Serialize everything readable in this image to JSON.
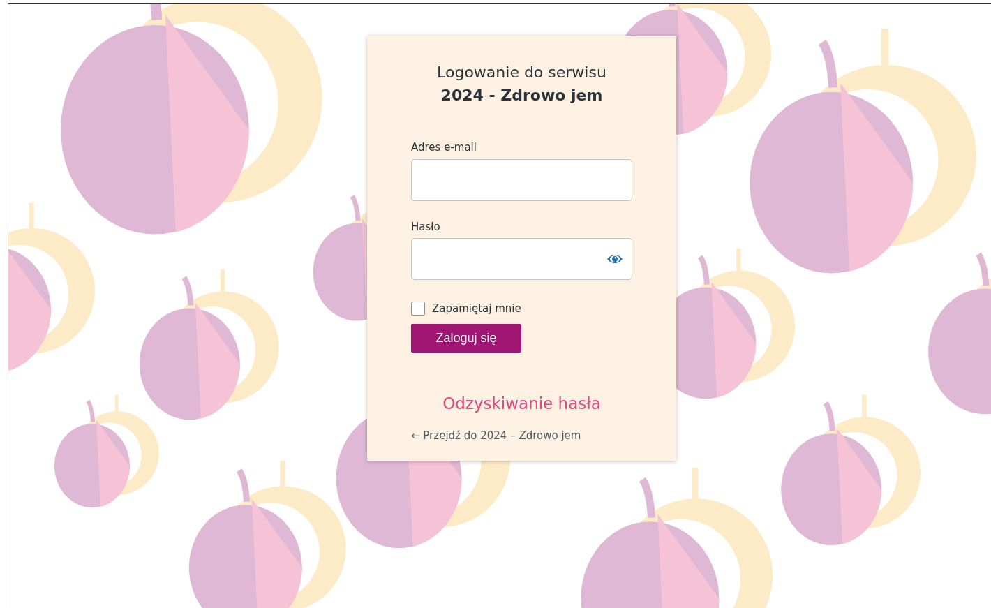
{
  "title": {
    "line": "Logowanie do serwisu",
    "site": "2024 - Zdrowo jem"
  },
  "fields": [
    {
      "kind": "text",
      "label": "Adres e-mail"
    },
    {
      "kind": "password",
      "label": "Hasło"
    }
  ],
  "remember": {
    "label": "Zapamiętaj mnie",
    "checked": false
  },
  "submit": {
    "label": "Zaloguj się"
  },
  "lost_password": "Odzyskiwanie hasła",
  "back_link": "← Przejdź do 2024 – Zdrowo jem"
}
